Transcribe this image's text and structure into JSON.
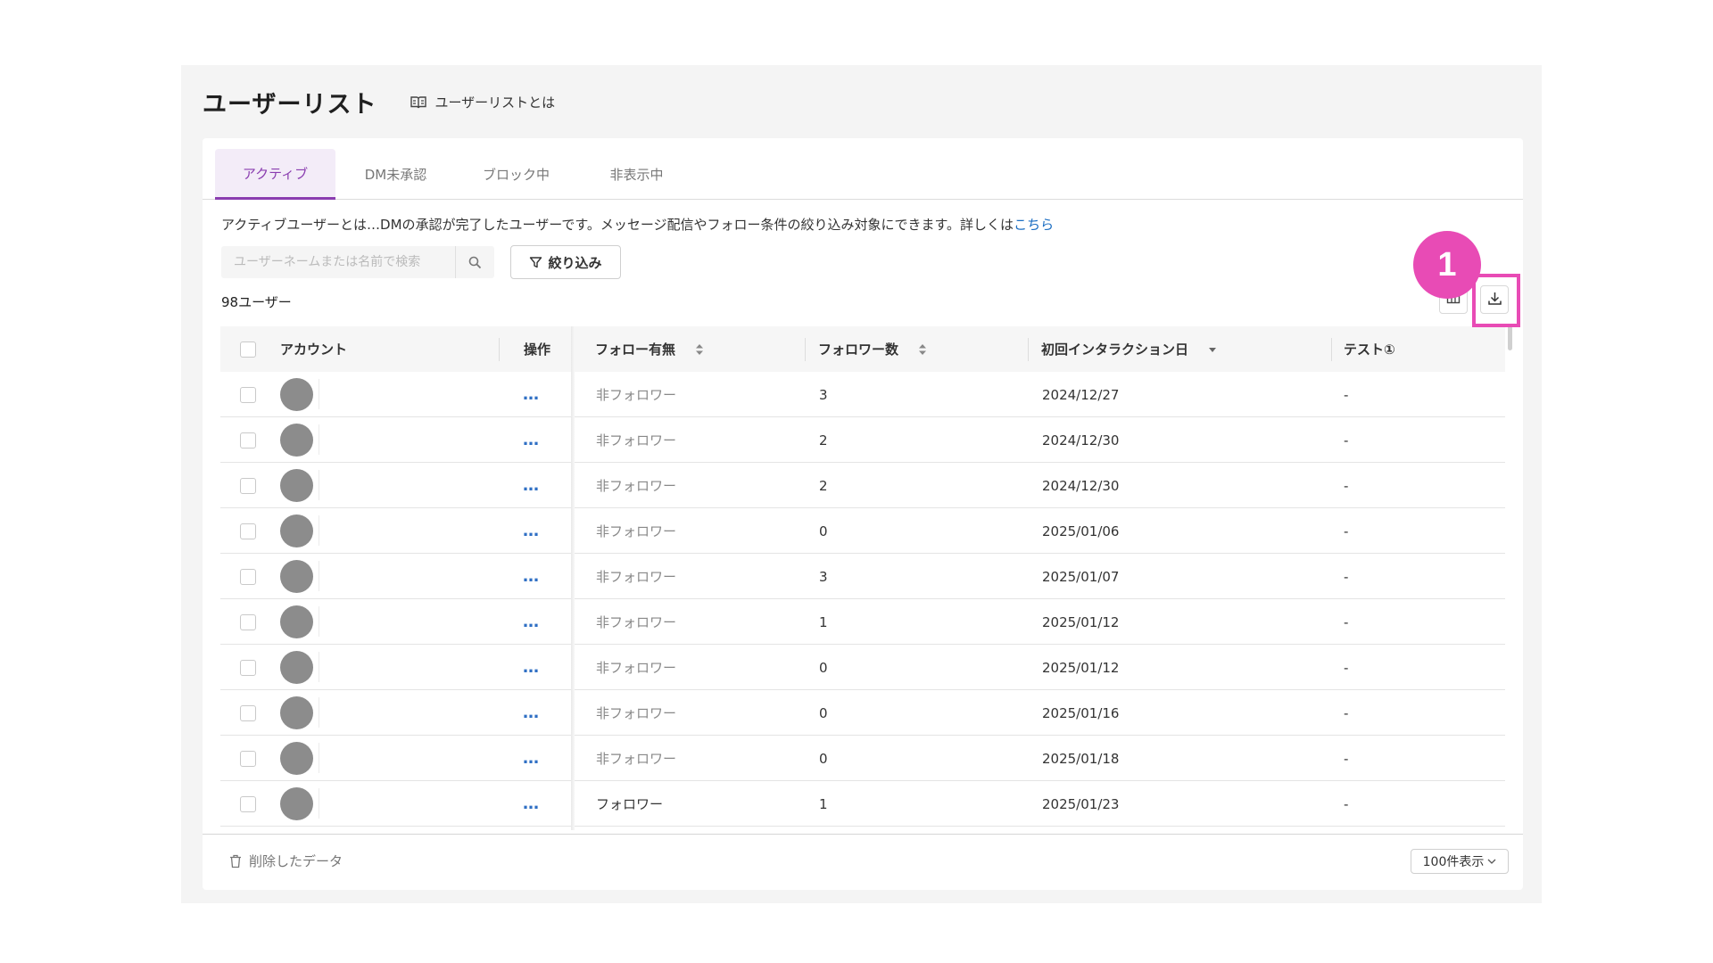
{
  "header": {
    "title": "ユーザーリスト",
    "help_link": "ユーザーリストとは"
  },
  "tabs": [
    {
      "label": "アクティブ",
      "active": true
    },
    {
      "label": "DM未承認",
      "active": false
    },
    {
      "label": "ブロック中",
      "active": false
    },
    {
      "label": "非表示中",
      "active": false
    }
  ],
  "description": {
    "text": "アクティブユーザーとは…DMの承認が完了したユーザーです。メッセージ配信やフォロー条件の絞り込み対象にできます。詳しくは",
    "link": "こちら"
  },
  "search": {
    "placeholder": "ユーザーネームまたは名前で検索",
    "value": ""
  },
  "filter_button": "絞り込み",
  "user_count": "98ユーザー",
  "annotation": {
    "step": "1",
    "color": "#e84bb5"
  },
  "table": {
    "columns": {
      "account": "アカウント",
      "action": "操作",
      "follow": "フォロー有無",
      "followers": "フォロワー数",
      "first_interaction": "初回インタラクション日",
      "test": "テスト①"
    },
    "rows": [
      {
        "action": "…",
        "follow": "非フォロワー",
        "followers": "3",
        "date": "2024/12/27",
        "test": "-"
      },
      {
        "action": "…",
        "follow": "非フォロワー",
        "followers": "2",
        "date": "2024/12/30",
        "test": "-"
      },
      {
        "action": "…",
        "follow": "非フォロワー",
        "followers": "2",
        "date": "2024/12/30",
        "test": "-"
      },
      {
        "action": "…",
        "follow": "非フォロワー",
        "followers": "0",
        "date": "2025/01/06",
        "test": "-"
      },
      {
        "action": "…",
        "follow": "非フォロワー",
        "followers": "3",
        "date": "2025/01/07",
        "test": "-"
      },
      {
        "action": "…",
        "follow": "非フォロワー",
        "followers": "1",
        "date": "2025/01/12",
        "test": "-"
      },
      {
        "action": "…",
        "follow": "非フォロワー",
        "followers": "0",
        "date": "2025/01/12",
        "test": "-"
      },
      {
        "action": "…",
        "follow": "非フォロワー",
        "followers": "0",
        "date": "2025/01/16",
        "test": "-"
      },
      {
        "action": "…",
        "follow": "非フォロワー",
        "followers": "0",
        "date": "2025/01/18",
        "test": "-"
      },
      {
        "action": "…",
        "follow": "フォロワー",
        "followers": "1",
        "date": "2025/01/23",
        "test": "-"
      }
    ]
  },
  "footer": {
    "deleted_data": "削除したデータ",
    "per_page": "100件表示"
  },
  "colors": {
    "accent": "#8a3db0",
    "link": "#1a6dc2",
    "highlight": "#e84bb5"
  }
}
